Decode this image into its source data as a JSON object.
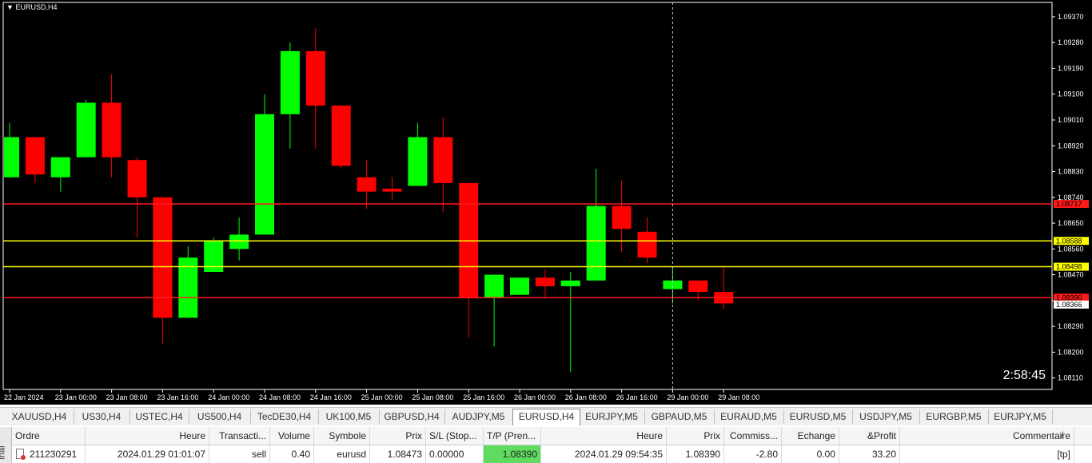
{
  "chart_title": "EURUSD,H4",
  "timer": "2:58:45",
  "chart_data": {
    "type": "candlestick",
    "symbol": "EURUSD",
    "timeframe": "H4",
    "title": "EURUSD,H4",
    "ylim": [
      1.0807,
      1.0942
    ],
    "y_ticks": [
      "1.09370",
      "1.09280",
      "1.09190",
      "1.09100",
      "1.09010",
      "1.08920",
      "1.08830",
      "1.08740",
      "1.08650",
      "1.08560",
      "1.08470",
      "1.08380",
      "1.08290",
      "1.08200",
      "1.08110"
    ],
    "x_ticks": [
      "22 Jan 2024",
      "23 Jan 00:00",
      "23 Jan 08:00",
      "23 Jan 16:00",
      "24 Jan 00:00",
      "24 Jan 08:00",
      "24 Jan 16:00",
      "25 Jan 00:00",
      "25 Jan 08:00",
      "25 Jan 16:00",
      "26 Jan 00:00",
      "26 Jan 08:00",
      "26 Jan 16:00",
      "29 Jan 00:00",
      "29 Jan 08:00"
    ],
    "candles": [
      {
        "o": 1.0881,
        "h": 1.09,
        "l": 1.0881,
        "c": 1.0895
      },
      {
        "o": 1.0895,
        "h": 1.0895,
        "l": 1.0879,
        "c": 1.0882
      },
      {
        "o": 1.0881,
        "h": 1.0888,
        "l": 1.0876,
        "c": 1.0888
      },
      {
        "o": 1.0888,
        "h": 1.0908,
        "l": 1.0888,
        "c": 1.0907
      },
      {
        "o": 1.0907,
        "h": 1.0917,
        "l": 1.0881,
        "c": 1.0888
      },
      {
        "o": 1.0887,
        "h": 1.0888,
        "l": 1.086,
        "c": 1.0874
      },
      {
        "o": 1.0874,
        "h": 1.0874,
        "l": 1.0823,
        "c": 1.0832
      },
      {
        "o": 1.0832,
        "h": 1.0857,
        "l": 1.0832,
        "c": 1.0853
      },
      {
        "o": 1.0848,
        "h": 1.086,
        "l": 1.0848,
        "c": 1.0859
      },
      {
        "o": 1.0856,
        "h": 1.0867,
        "l": 1.0852,
        "c": 1.0861
      },
      {
        "o": 1.0861,
        "h": 1.091,
        "l": 1.0861,
        "c": 1.0903
      },
      {
        "o": 1.0903,
        "h": 1.0928,
        "l": 1.0891,
        "c": 1.0925
      },
      {
        "o": 1.0925,
        "h": 1.0933,
        "l": 1.0891,
        "c": 1.0906
      },
      {
        "o": 1.0906,
        "h": 1.0906,
        "l": 1.0884,
        "c": 1.0885
      },
      {
        "o": 1.0881,
        "h": 1.0887,
        "l": 1.087,
        "c": 1.0876
      },
      {
        "o": 1.0877,
        "h": 1.0881,
        "l": 1.0873,
        "c": 1.0876
      },
      {
        "o": 1.0878,
        "h": 1.09,
        "l": 1.0878,
        "c": 1.0895
      },
      {
        "o": 1.0895,
        "h": 1.0902,
        "l": 1.0869,
        "c": 1.0879
      },
      {
        "o": 1.0879,
        "h": 1.0879,
        "l": 1.0825,
        "c": 1.0839
      },
      {
        "o": 1.0839,
        "h": 1.0847,
        "l": 1.0822,
        "c": 1.0847
      },
      {
        "o": 1.084,
        "h": 1.0846,
        "l": 1.084,
        "c": 1.0846
      },
      {
        "o": 1.0846,
        "h": 1.0849,
        "l": 1.0839,
        "c": 1.0843
      },
      {
        "o": 1.0843,
        "h": 1.0848,
        "l": 1.0813,
        "c": 1.0845
      },
      {
        "o": 1.0845,
        "h": 1.0884,
        "l": 1.0845,
        "c": 1.0871
      },
      {
        "o": 1.0871,
        "h": 1.088,
        "l": 1.0855,
        "c": 1.0863
      },
      {
        "o": 1.0862,
        "h": 1.0867,
        "l": 1.0851,
        "c": 1.0853
      },
      {
        "o": 1.0842,
        "h": 1.085,
        "l": 1.0837,
        "c": 1.0845
      },
      {
        "o": 1.0845,
        "h": 1.0845,
        "l": 1.0838,
        "c": 1.0841
      },
      {
        "o": 1.0841,
        "h": 1.085,
        "l": 1.0835,
        "c": 1.0837
      }
    ],
    "price_lines": [
      {
        "value": 1.08717,
        "color": "#ff1a1a",
        "label": "1.08717"
      },
      {
        "value": 1.08588,
        "color": "#ffff00",
        "label": "1.08588"
      },
      {
        "value": 1.08498,
        "color": "#ffff00",
        "label": "1.08498"
      },
      {
        "value": 1.0839,
        "color": "#ff1a1a",
        "label": "1.08390"
      }
    ],
    "current_price": "1.08366",
    "bull_color": "#00ff00",
    "bear_color": "#ff0000",
    "grid": false
  },
  "tabs": [
    "XAUUSD,H4",
    "US30,H4",
    "USTEC,H4",
    "US500,H4",
    "TecDE30,H4",
    "UK100,M5",
    "GBPUSD,H4",
    "AUDJPY,M5",
    "EURUSD,H4",
    "EURJPY,M5",
    "GBPAUD,M5",
    "EURAUD,M5",
    "EURUSD,M5",
    "USDJPY,M5",
    "EURGBP,M5",
    "EURJPY,M5"
  ],
  "active_tab": "EURUSD,H4",
  "side_label": "inal",
  "table": {
    "headers": [
      "Ordre",
      "Heure",
      "Transacti...",
      "Volume",
      "Symbole",
      "Prix",
      "S/L (Stop...",
      "T/P (Pren...",
      "Heure",
      "Prix",
      "Commiss...",
      "Echange",
      "&Profit",
      "Commentaire"
    ],
    "rows": [
      [
        "211230291",
        "2024.01.29 01:01:07",
        "sell",
        "0.40",
        "eurusd",
        "1.08473",
        "0.00000",
        "1.08390",
        "2024.01.29 09:54:35",
        "1.08390",
        "-2.80",
        "0.00",
        "33.20",
        "[tp]"
      ]
    ]
  },
  "colors": {
    "tp_highlight": "#5fdc5f",
    "chart_bg": "#000000"
  }
}
